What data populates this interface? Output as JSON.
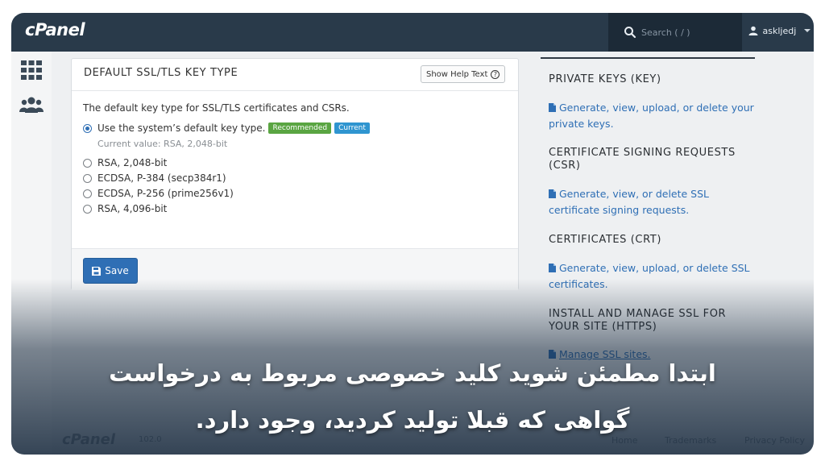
{
  "app": {
    "logo": "cPanel"
  },
  "header": {
    "search_placeholder": "Search ( / )",
    "username": "askljedj"
  },
  "card": {
    "title": "DEFAULT SSL/TLS KEY TYPE",
    "help_button": "Show Help Text",
    "description": "The default key type for SSL/TLS certificates and CSRs.",
    "options": [
      {
        "label": "Use the system’s default key type.",
        "checked": true
      },
      {
        "label": "RSA, 2,048-bit",
        "checked": false
      },
      {
        "label": "ECDSA, P-384 (secp384r1)",
        "checked": false
      },
      {
        "label": "ECDSA, P-256 (prime256v1)",
        "checked": false
      },
      {
        "label": "RSA, 4,096-bit",
        "checked": false
      }
    ],
    "badges": {
      "recommended": "Recommended",
      "current": "Current"
    },
    "current_value": "Current value: RSA, 2,048-bit",
    "save_label": "Save"
  },
  "right": {
    "sections": [
      {
        "title": "PRIVATE KEYS (KEY)",
        "link": "Generate, view, upload, or delete your private keys."
      },
      {
        "title": "CERTIFICATE SIGNING REQUESTS (CSR)",
        "link": "Generate, view, or delete SSL certificate signing requests."
      },
      {
        "title": "CERTIFICATES (CRT)",
        "link": "Generate, view, upload, or delete SSL certificates."
      },
      {
        "title": "INSTALL AND MANAGE SSL FOR YOUR SITE (HTTPS)",
        "link": "Manage SSL sites."
      }
    ]
  },
  "footer": {
    "logo": "cPanel",
    "version": "102.0",
    "links": [
      "Home",
      "Trademarks",
      "Privacy Policy"
    ]
  },
  "caption": {
    "line1": "ابتدا مطمئن شوید کلید خصوصی مربوط به درخواست",
    "line2": "گواهی که قبلا تولید کردید، وجود دارد."
  },
  "colors": {
    "topbar": "#293a4a",
    "accent": "#2f6fb5",
    "recommended": "#5aa542",
    "current": "#2f95d0"
  }
}
